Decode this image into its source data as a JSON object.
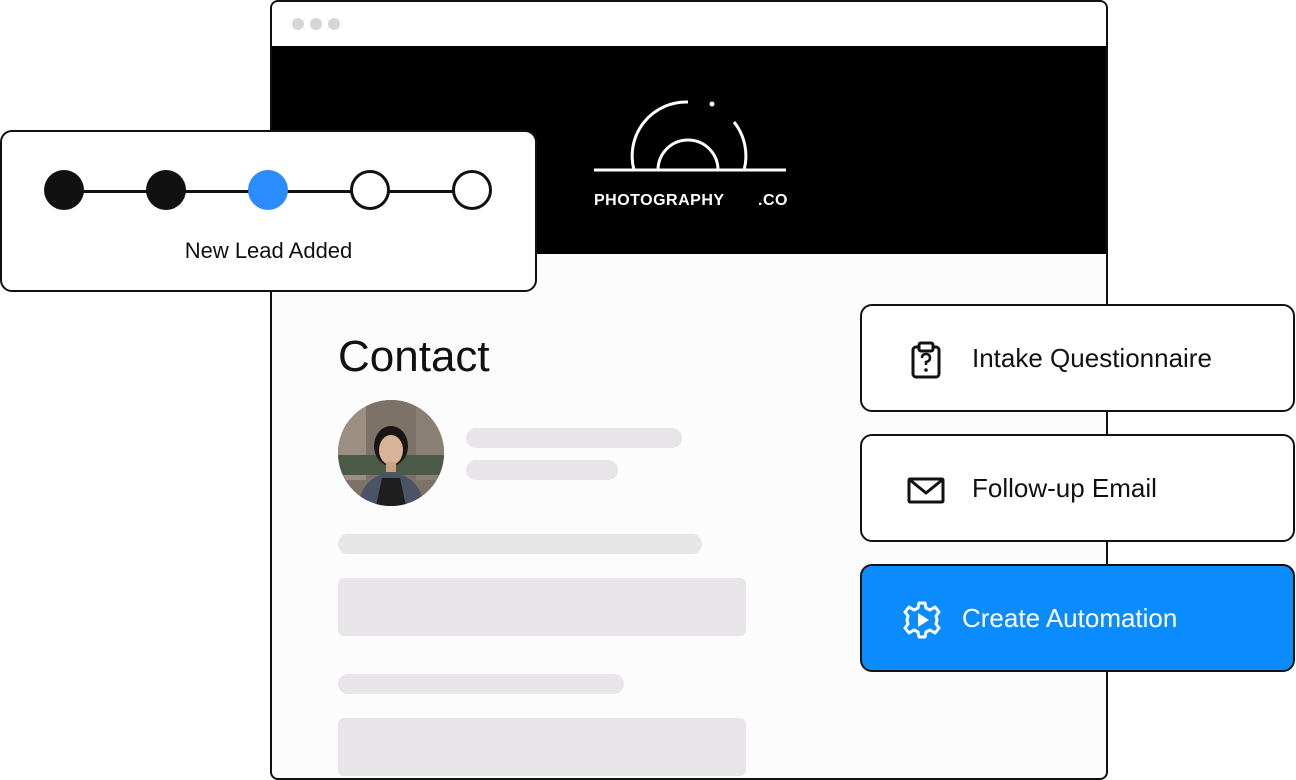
{
  "brand": {
    "name": "PHOTOGRAPHY",
    "suffix": ".CO"
  },
  "contact": {
    "title": "Contact"
  },
  "workflow": {
    "status_label": "New Lead Added",
    "steps": [
      "done",
      "done",
      "current",
      "todo",
      "todo"
    ]
  },
  "actions": [
    {
      "label": "Intake Questionnaire",
      "icon": "clipboard-question-icon"
    },
    {
      "label": "Follow-up Email",
      "icon": "envelope-icon"
    },
    {
      "label": "Create Automation",
      "icon": "gear-play-icon"
    }
  ],
  "colors": {
    "accent": "#0a8cff",
    "current_step": "#2a8cff",
    "banner": "#000000",
    "placeholder": "#e8e5e8"
  }
}
